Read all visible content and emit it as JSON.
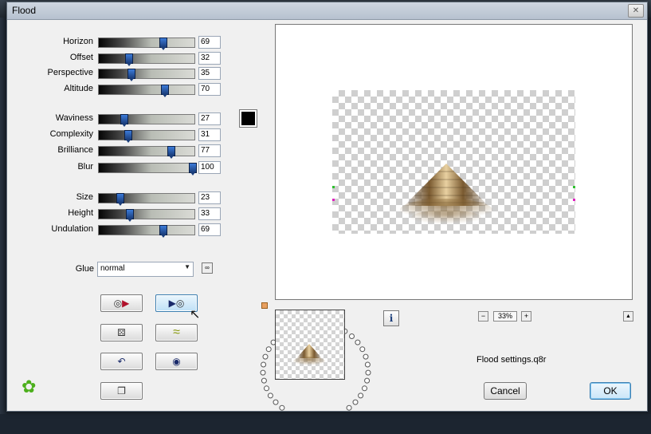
{
  "window": {
    "title": "Flood"
  },
  "params_group1": [
    {
      "label": "Horizon",
      "value": "69"
    },
    {
      "label": "Offset",
      "value": "32"
    },
    {
      "label": "Perspective",
      "value": "35"
    },
    {
      "label": "Altitude",
      "value": "70"
    }
  ],
  "params_group2": [
    {
      "label": "Waviness",
      "value": "27"
    },
    {
      "label": "Complexity",
      "value": "31"
    },
    {
      "label": "Brilliance",
      "value": "77"
    },
    {
      "label": "Blur",
      "value": "100"
    }
  ],
  "params_group3": [
    {
      "label": "Size",
      "value": "23"
    },
    {
      "label": "Height",
      "value": "33"
    },
    {
      "label": "Undulation",
      "value": "69"
    }
  ],
  "color_swatch": "#000000",
  "glue": {
    "label": "Glue",
    "value": "normal"
  },
  "zoom": "33%",
  "preset_file": "Flood settings.q8r",
  "buttons": {
    "cancel": "Cancel",
    "ok": "OK"
  },
  "icons": [
    "close-icon",
    "preset-load-icon",
    "preset-save-icon",
    "randomize-dice-icon",
    "random-wave-icon",
    "reset-icon",
    "default-icon",
    "copy-icon",
    "info-icon",
    "zoom-out-icon",
    "zoom-in-icon",
    "collapse-icon",
    "logo-icon",
    "glue-link-icon"
  ]
}
